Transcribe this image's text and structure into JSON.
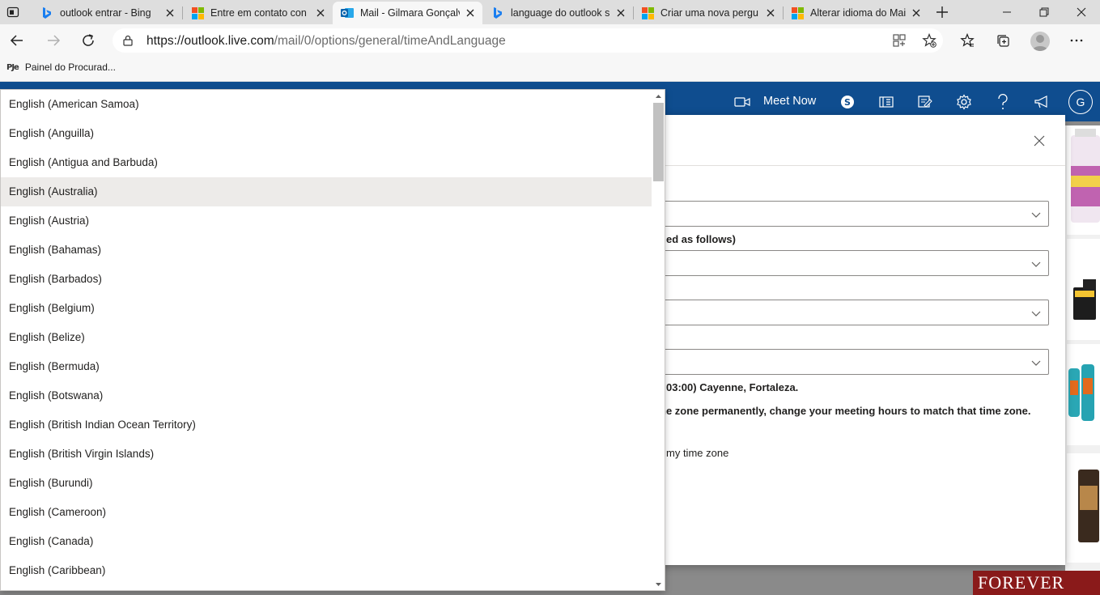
{
  "browser": {
    "tabs": [
      {
        "title": "outlook entrar - Bing",
        "icon": "bing-icon"
      },
      {
        "title": "Entre em contato con",
        "icon": "microsoft-icon"
      },
      {
        "title": "Mail - Gilmara Gonçalv",
        "icon": "outlook-icon"
      },
      {
        "title": "language do outlook s",
        "icon": "bing-icon"
      },
      {
        "title": "Criar uma nova pergu",
        "icon": "microsoft-icon"
      },
      {
        "title": "Alterar idioma do Mai",
        "icon": "microsoft-icon"
      }
    ],
    "active_tab_index": 2,
    "url_host": "https://outlook.live.com",
    "url_path": "/mail/0/options/general/timeAndLanguage",
    "favorites": [
      {
        "label": "Painel do Procurad...",
        "logo": "PJe"
      }
    ]
  },
  "outlook": {
    "meet_now_label": "Meet Now",
    "user_initial": "G"
  },
  "dialog": {
    "text_date_format_suffix": "ed as follows)",
    "text_current_timezone": "03:00) Cayenne, Fortaleza.",
    "text_timezone_note": "ne zone permanently, change your meeting hours to match that time zone.",
    "text_checkbox_suffix": "my time zone"
  },
  "dropdown": {
    "hover_index": 3,
    "items": [
      "English (American Samoa)",
      "English (Anguilla)",
      "English (Antigua and Barbuda)",
      "English (Australia)",
      "English (Austria)",
      "English (Bahamas)",
      "English (Barbados)",
      "English (Belgium)",
      "English (Belize)",
      "English (Bermuda)",
      "English (Botswana)",
      "English (British Indian Ocean Territory)",
      "English (British Virgin Islands)",
      "English (Burundi)",
      "English (Cameroon)",
      "English (Canada)",
      "English (Caribbean)"
    ]
  },
  "ads": {
    "banner_text": "FOREVER"
  },
  "colors": {
    "outlook_header": "#0f4d8f",
    "hover_item": "#edebe9"
  }
}
